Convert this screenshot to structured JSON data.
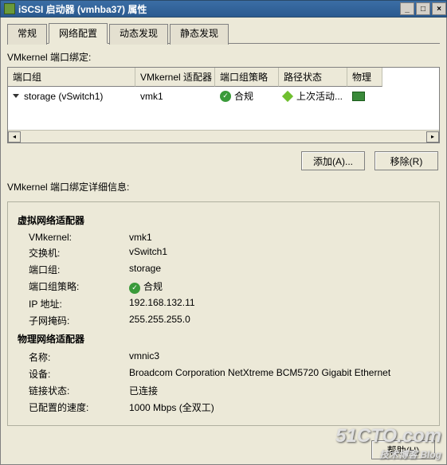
{
  "title": "iSCSI 启动器 (vmhba37) 属性",
  "window_buttons": {
    "min": "_",
    "max": "□",
    "close": "×"
  },
  "tabs": [
    "常规",
    "网络配置",
    "动态发现",
    "静态发现"
  ],
  "active_tab_index": 1,
  "binding_label": "VMkernel 端口绑定:",
  "grid": {
    "headers": [
      "端口组",
      "VMkernel 适配器",
      "端口组策略",
      "路径状态",
      "物理"
    ],
    "rows": [
      {
        "portgroup": "storage (vSwitch1)",
        "adapter": "vmk1",
        "policy": "合规",
        "path": "上次活动...",
        "phys_icon": "nic"
      }
    ]
  },
  "buttons": {
    "add": "添加(A)...",
    "remove": "移除(R)"
  },
  "details_label": "VMkernel 端口绑定详细信息:",
  "virtual": {
    "title": "虚拟网络适配器",
    "rows": {
      "vmkern_k": "VMkernel:",
      "vmkern_v": "vmk1",
      "switch_k": "交换机:",
      "switch_v": "vSwitch1",
      "pg_k": "端口组:",
      "pg_v": "storage",
      "policy_k": "端口组策略:",
      "policy_v": "合规",
      "ip_k": "IP 地址:",
      "ip_v": "192.168.132.11",
      "mask_k": "子网掩码:",
      "mask_v": "255.255.255.0"
    }
  },
  "physical": {
    "title": "物理网络适配器",
    "rows": {
      "name_k": "名称:",
      "name_v": "vmnic3",
      "dev_k": "设备:",
      "dev_v": "Broadcom Corporation NetXtreme BCM5720 Gigabit Ethernet",
      "link_k": "链接状态:",
      "link_v": "已连接",
      "speed_k": "已配置的速度:",
      "speed_v": "1000 Mbps (全双工)"
    }
  },
  "help_button": "帮助(H)",
  "watermark": {
    "main": "51CTO.com",
    "sub": "技术博客  Blog"
  }
}
